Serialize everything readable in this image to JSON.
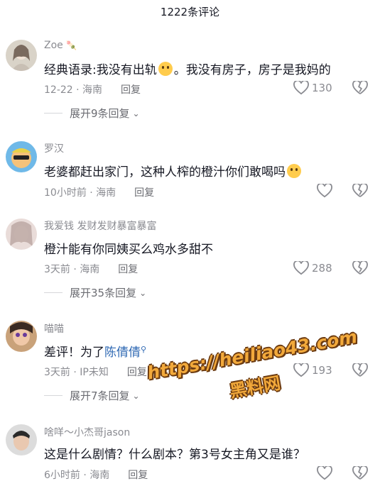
{
  "header": {
    "title": "1222条评论"
  },
  "comments": [
    {
      "name": "Zoe",
      "text": "经典语录:我没有出轨",
      "text_after_emoji": "。我没有房子，房子是我妈的",
      "time": "12-22 · 海南",
      "reply": "回复",
      "likes": "130",
      "expand": "展开9条回复"
    },
    {
      "name": "罗汉",
      "text": "老婆都赶出家门，这种人榨的橙汁你们敢喝吗",
      "time": "10小时前 · 海南",
      "reply": "回复",
      "likes": ""
    },
    {
      "name": "我爱钱  发财发财暴富暴富",
      "text": "橙汁能有你同姨买么鸡水多甜不",
      "time": "3天前 · 海南",
      "reply": "回复",
      "likes": "288",
      "expand": "展开35条回复"
    },
    {
      "name": "喵喵",
      "text": "差评！为了",
      "mention": "陈倩倩",
      "time": "3天前 · IP未知",
      "reply": "回复",
      "likes": "193",
      "expand": "展开7条回复"
    },
    {
      "name": "啥咩～小杰哥jason",
      "text": "这是什么剧情？什么剧本？第3号女主角又是谁？",
      "time": "6小时前 · 海南",
      "reply": "回复",
      "likes": ""
    }
  ],
  "watermark": {
    "url": "https://heiliao43.com",
    "name": "黑料网"
  },
  "colors": {
    "meta": "#8a8b91",
    "mention": "#2e68b3",
    "watermark": "#f2a93b"
  }
}
